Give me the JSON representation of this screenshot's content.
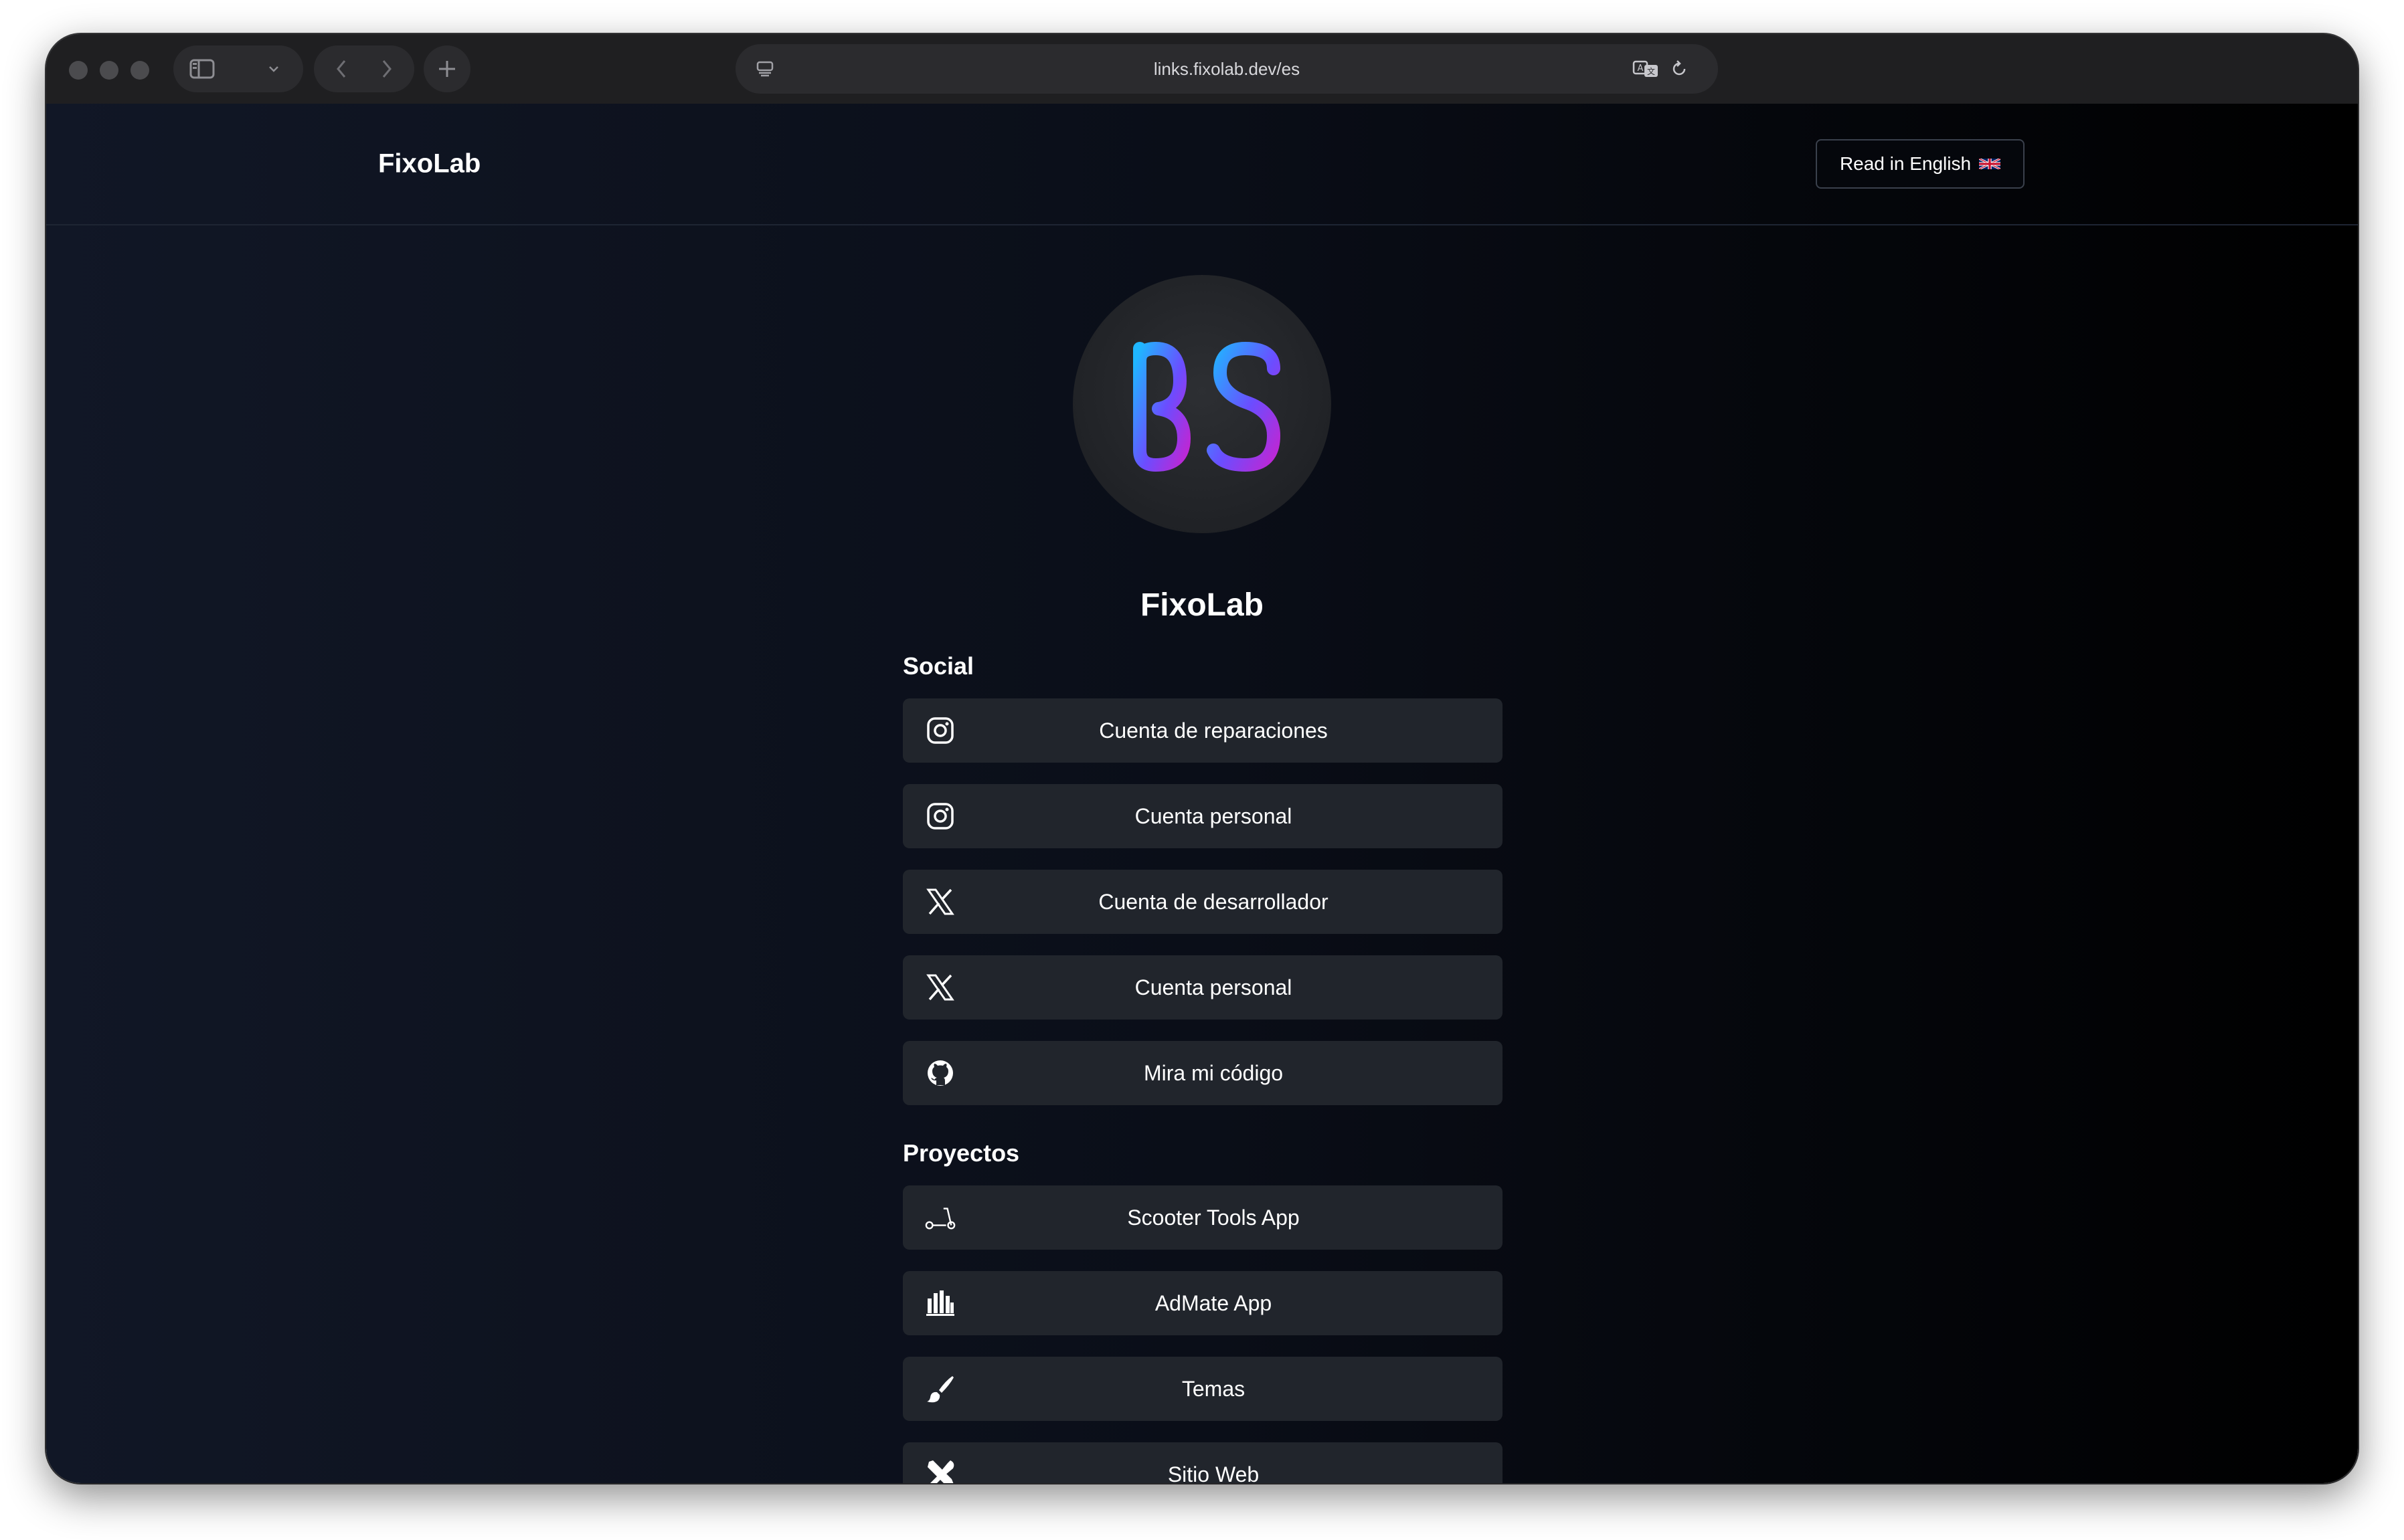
{
  "browser": {
    "url": "links.fixolab.dev/es"
  },
  "header": {
    "brand": "FixoLab",
    "lang_button": "Read in English",
    "lang_flag": "uk-flag-icon"
  },
  "profile": {
    "name": "FixoLab",
    "avatar_icon": "fixolab-logo-icon",
    "logo_colors": [
      "#1fb6ff",
      "#6b4dff",
      "#c026d3"
    ]
  },
  "sections": {
    "social": {
      "title": "Social",
      "items": [
        {
          "label": "Cuenta de reparaciones",
          "icon": "instagram-icon"
        },
        {
          "label": "Cuenta personal",
          "icon": "instagram-icon"
        },
        {
          "label": "Cuenta de desarrollador",
          "icon": "x-icon"
        },
        {
          "label": "Cuenta personal",
          "icon": "x-icon"
        },
        {
          "label": "Mira mi código",
          "icon": "github-icon"
        }
      ]
    },
    "projects": {
      "title": "Proyectos",
      "items": [
        {
          "label": "Scooter Tools App",
          "icon": "scooter-icon"
        },
        {
          "label": "AdMate App",
          "icon": "bar-chart-icon"
        },
        {
          "label": "Temas",
          "icon": "paintbrush-icon"
        },
        {
          "label": "Sitio Web",
          "icon": "tools-icon"
        }
      ]
    }
  },
  "colors": {
    "button_bg": "#21252c",
    "page_bg_left": "#111726",
    "page_bg_right": "#000000"
  }
}
